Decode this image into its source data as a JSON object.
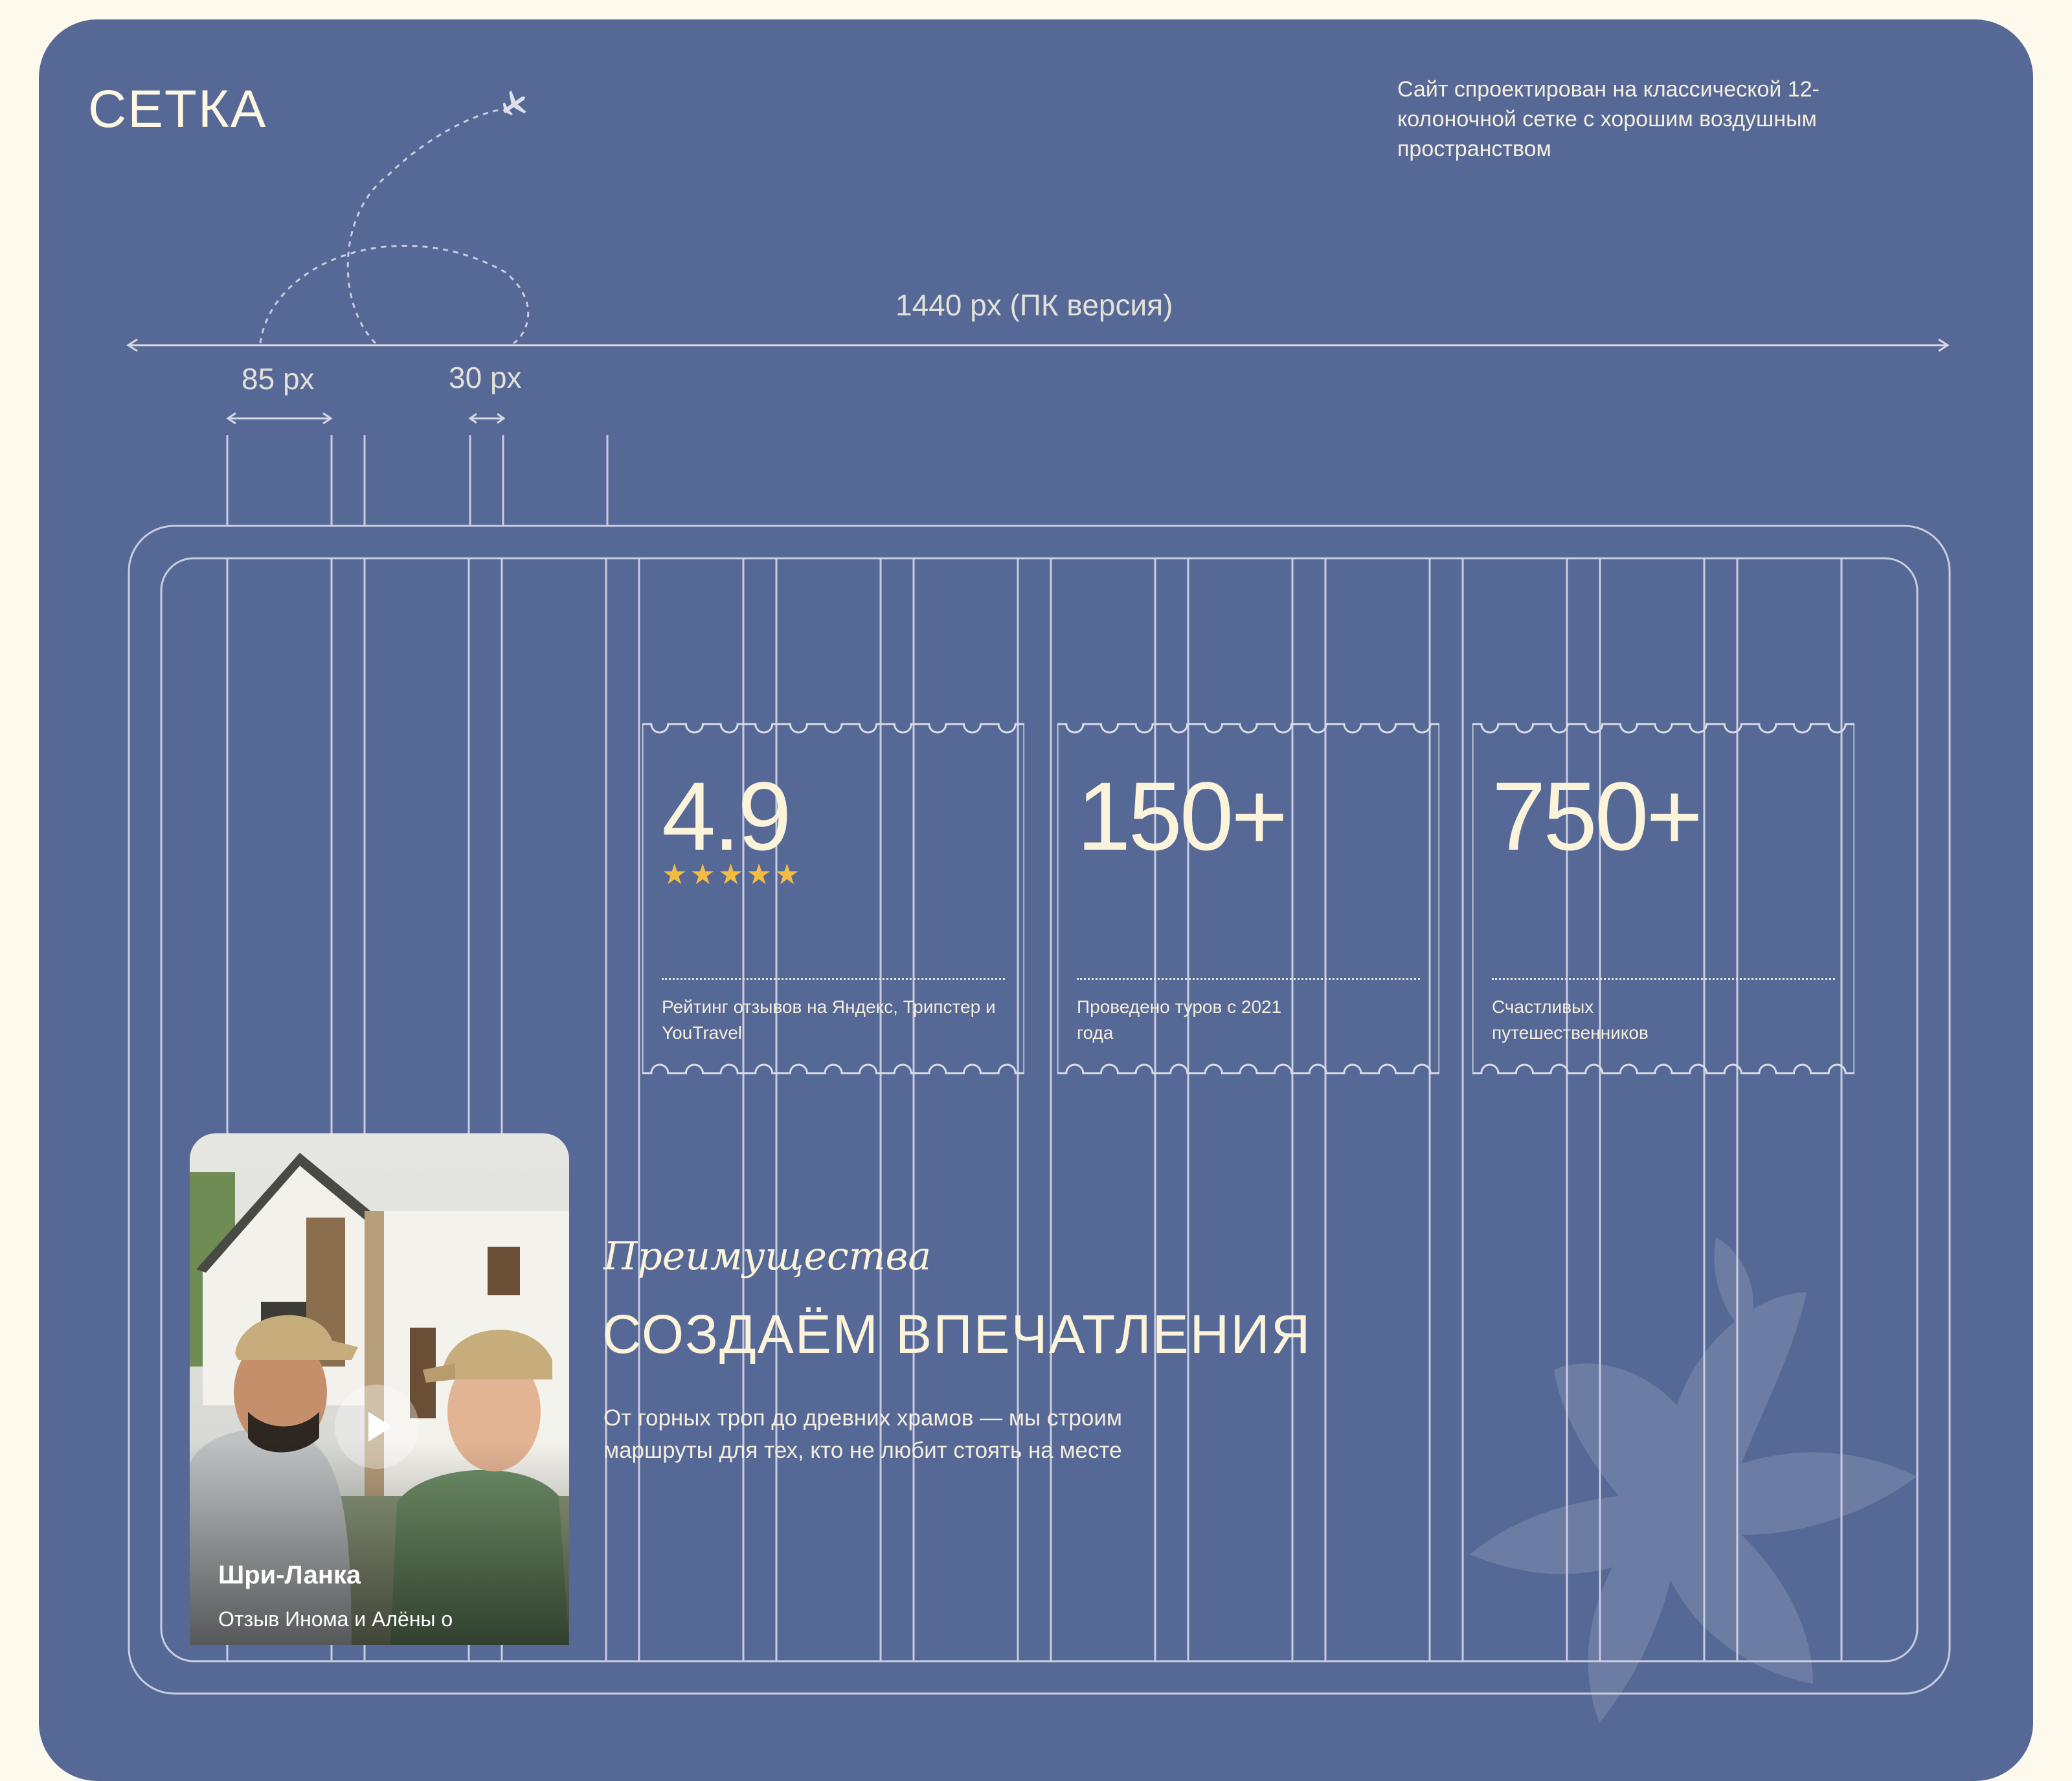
{
  "section": {
    "title": "СЕТКА",
    "description": "Сайт спроектирован на классической 12- колоночной сетке с хорошим воздушным пространством"
  },
  "dimensions": {
    "page_width": "1440 px (ПК версия)",
    "column_width": "85 px",
    "gutter_width": "30 px"
  },
  "stats": [
    {
      "value": "4.9",
      "stars": "★★★★★",
      "caption": "Рейтинг отзывов на Яндекс, Трипстер и YouTravel"
    },
    {
      "value": "150+",
      "caption": "Проведено туров с 2021 года"
    },
    {
      "value": "750+",
      "caption": "Счастливых путешественников"
    }
  ],
  "rating": {
    "value": 4.9,
    "max": 5
  },
  "video_card": {
    "title": "Шри-Ланка",
    "subtitle": "Отзыв Инома и Алёны о"
  },
  "advantages": {
    "script_label": "Преимущества",
    "headline": "СОЗДАЁМ ВПЕЧАТЛЕНИЯ",
    "text": "От горных троп до древних храмов — мы строим маршруты для тех, кто не любит стоять на месте"
  },
  "colors": {
    "page_background": "#fdf9ec",
    "card_background": "#566895",
    "text_cream": "#fbf4da",
    "star_gold": "#f3bd45",
    "grid_line": "#c9cde0"
  }
}
